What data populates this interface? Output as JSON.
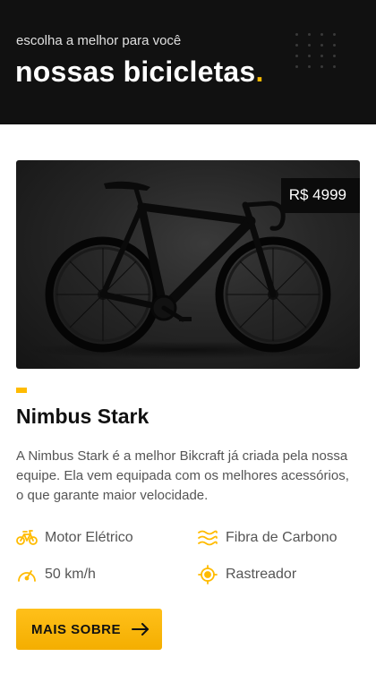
{
  "header": {
    "subtitle": "escolha a melhor para você",
    "title": "nossas bicicletas",
    "title_dot": "."
  },
  "product": {
    "image_alt": "Nimbus Stark",
    "price": "R$ 4999",
    "name": "Nimbus Stark",
    "description": "A Nimbus Stark é a melhor Bikcraft já criada pela nossa equipe. Ela vem equipada com os melhores acessórios, o que garante maior velocidade.",
    "features": [
      {
        "label": "Motor Elétrico",
        "icon": "electric-bike-icon"
      },
      {
        "label": "Fibra de Carbono",
        "icon": "carbon-waves-icon"
      },
      {
        "label": "50 km/h",
        "icon": "speedometer-icon"
      },
      {
        "label": "Rastreador",
        "icon": "tracker-target-icon"
      }
    ],
    "button_label": "MAIS SOBRE"
  },
  "colors": {
    "accent": "#ffbb00",
    "dark": "#111111",
    "text_muted": "#555555"
  }
}
